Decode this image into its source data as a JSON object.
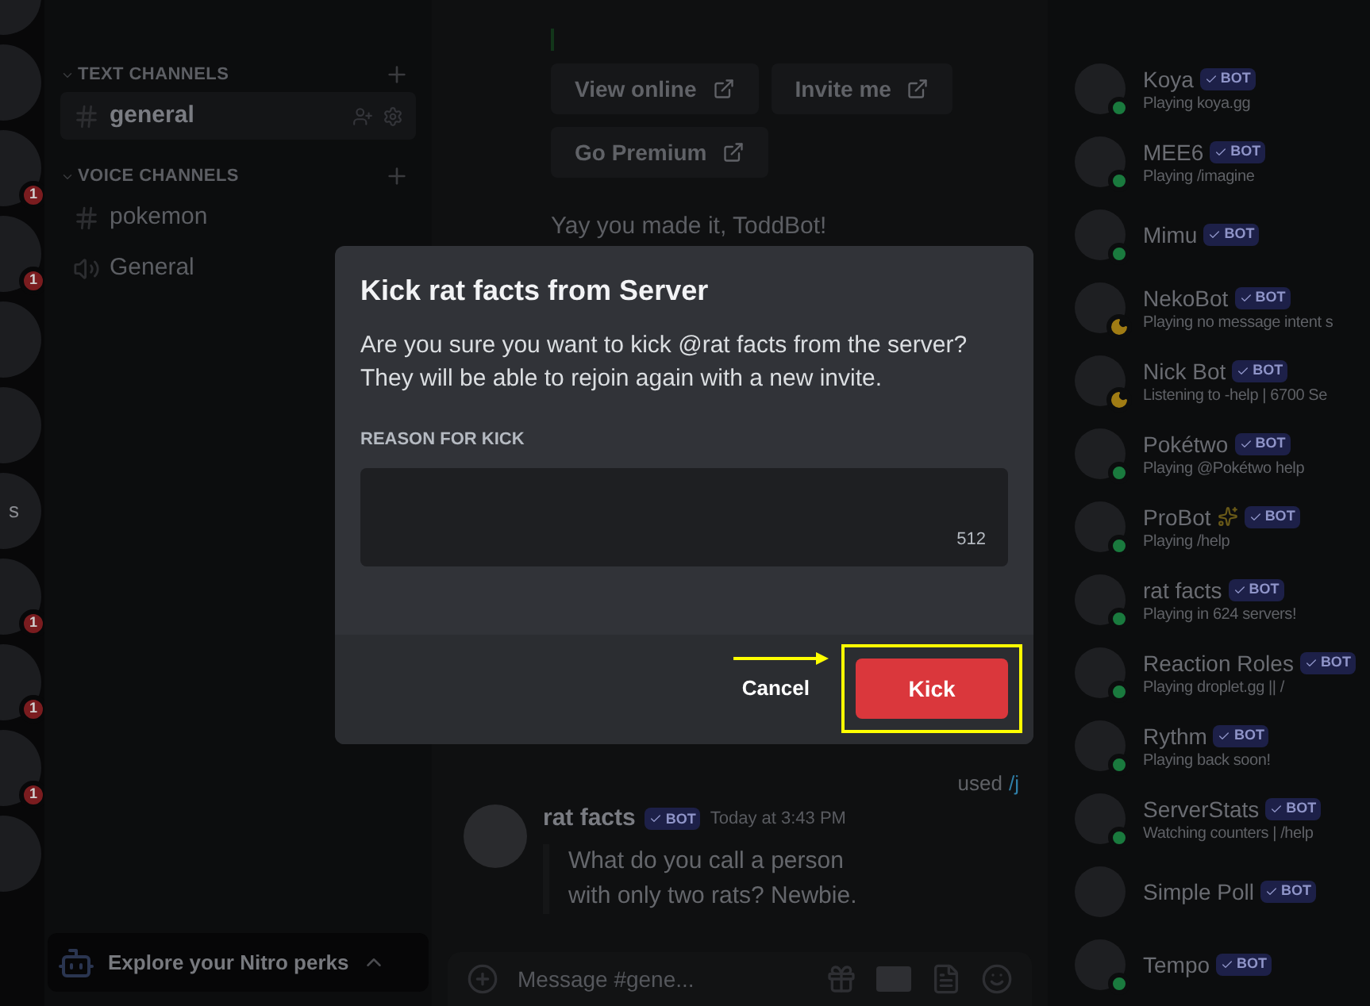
{
  "server_rail": [
    {
      "kind": "icon"
    },
    {
      "kind": "icon"
    },
    {
      "kind": "icon",
      "badge": "1"
    },
    {
      "kind": "icon",
      "badge": "1"
    },
    {
      "kind": "icon"
    },
    {
      "kind": "icon"
    },
    {
      "kind": "icon",
      "label": "s"
    },
    {
      "kind": "icon",
      "badge": "1"
    },
    {
      "kind": "icon",
      "badge": "1"
    },
    {
      "kind": "icon",
      "badge": "1"
    },
    {
      "kind": "icon"
    }
  ],
  "channel_sidebar": {
    "categories": [
      {
        "title": "TEXT CHANNELS",
        "channels": [
          {
            "name": "general",
            "kind": "text",
            "selected": true
          }
        ]
      },
      {
        "title": "VOICE CHANNELS",
        "channels": [
          {
            "name": "pokemon",
            "kind": "text",
            "selected": false
          },
          {
            "name": "General",
            "kind": "voice",
            "selected": false
          }
        ]
      }
    ],
    "nitro_banner": "Explore your Nitro perks"
  },
  "chat": {
    "link_buttons": [
      "View online",
      "Invite me",
      "Go Premium"
    ],
    "welcome": "Yay you made it, ToddBot!",
    "reply_used": "used",
    "reply_command": "/j",
    "message": {
      "author": "rat facts",
      "tag": "BOT",
      "time": "Today at 3:43 PM",
      "text": "What do you call a person with only two rats? Newbie."
    },
    "composer": {
      "placeholder": "Message #gene..."
    }
  },
  "members": [
    {
      "name": "Koya",
      "tag": "BOT",
      "activity": "Playing koya.gg",
      "status_dot": true,
      "idle": false,
      "sparkle": false
    },
    {
      "name": "MEE6",
      "tag": "BOT",
      "activity": "Playing /imagine",
      "status_dot": true,
      "idle": false,
      "sparkle": false
    },
    {
      "name": "Mimu",
      "tag": "BOT",
      "status_dot": true,
      "idle": false,
      "sparkle": false
    },
    {
      "name": "NekoBot",
      "tag": "BOT",
      "activity": "Playing no message intent s",
      "status_dot": true,
      "idle": true,
      "sparkle": false
    },
    {
      "name": "Nick Bot",
      "tag": "BOT",
      "activity": "Listening to -help | 6700 Se",
      "status_dot": true,
      "idle": true,
      "sparkle": false
    },
    {
      "name": "Pokétwo",
      "tag": "BOT",
      "activity": "Playing @Pokétwo help",
      "status_dot": true,
      "idle": false,
      "sparkle": false
    },
    {
      "name": "ProBot",
      "tag": "BOT",
      "activity": "Playing /help",
      "status_dot": true,
      "idle": false,
      "sparkle": true
    },
    {
      "name": "rat facts",
      "tag": "BOT",
      "activity": "Playing in 624 servers!",
      "status_dot": true,
      "idle": false,
      "sparkle": false
    },
    {
      "name": "Reaction Roles",
      "tag": "BOT",
      "activity": "Playing droplet.gg || /",
      "status_dot": true,
      "idle": false,
      "sparkle": false
    },
    {
      "name": "Rythm",
      "tag": "BOT",
      "activity": "Playing back soon!",
      "status_dot": true,
      "idle": false,
      "sparkle": false
    },
    {
      "name": "ServerStats",
      "tag": "BOT",
      "activity": "Watching counters | /help",
      "status_dot": true,
      "idle": false,
      "sparkle": false
    },
    {
      "name": "Simple Poll",
      "tag": "BOT",
      "status_dot": false,
      "sparkle": false
    },
    {
      "name": "Tempo",
      "tag": "BOT",
      "status_dot": true,
      "idle": false,
      "sparkle": false
    }
  ],
  "kick_dialog": {
    "title": "Kick rat facts from Server",
    "body": "Are you sure you want to kick @rat facts from the server? They will be able to rejoin again with a new invite.",
    "reason_label": "REASON FOR KICK",
    "char_count": "512",
    "cancel": "Cancel",
    "confirm": "Kick",
    "highlight_confirm": true
  }
}
